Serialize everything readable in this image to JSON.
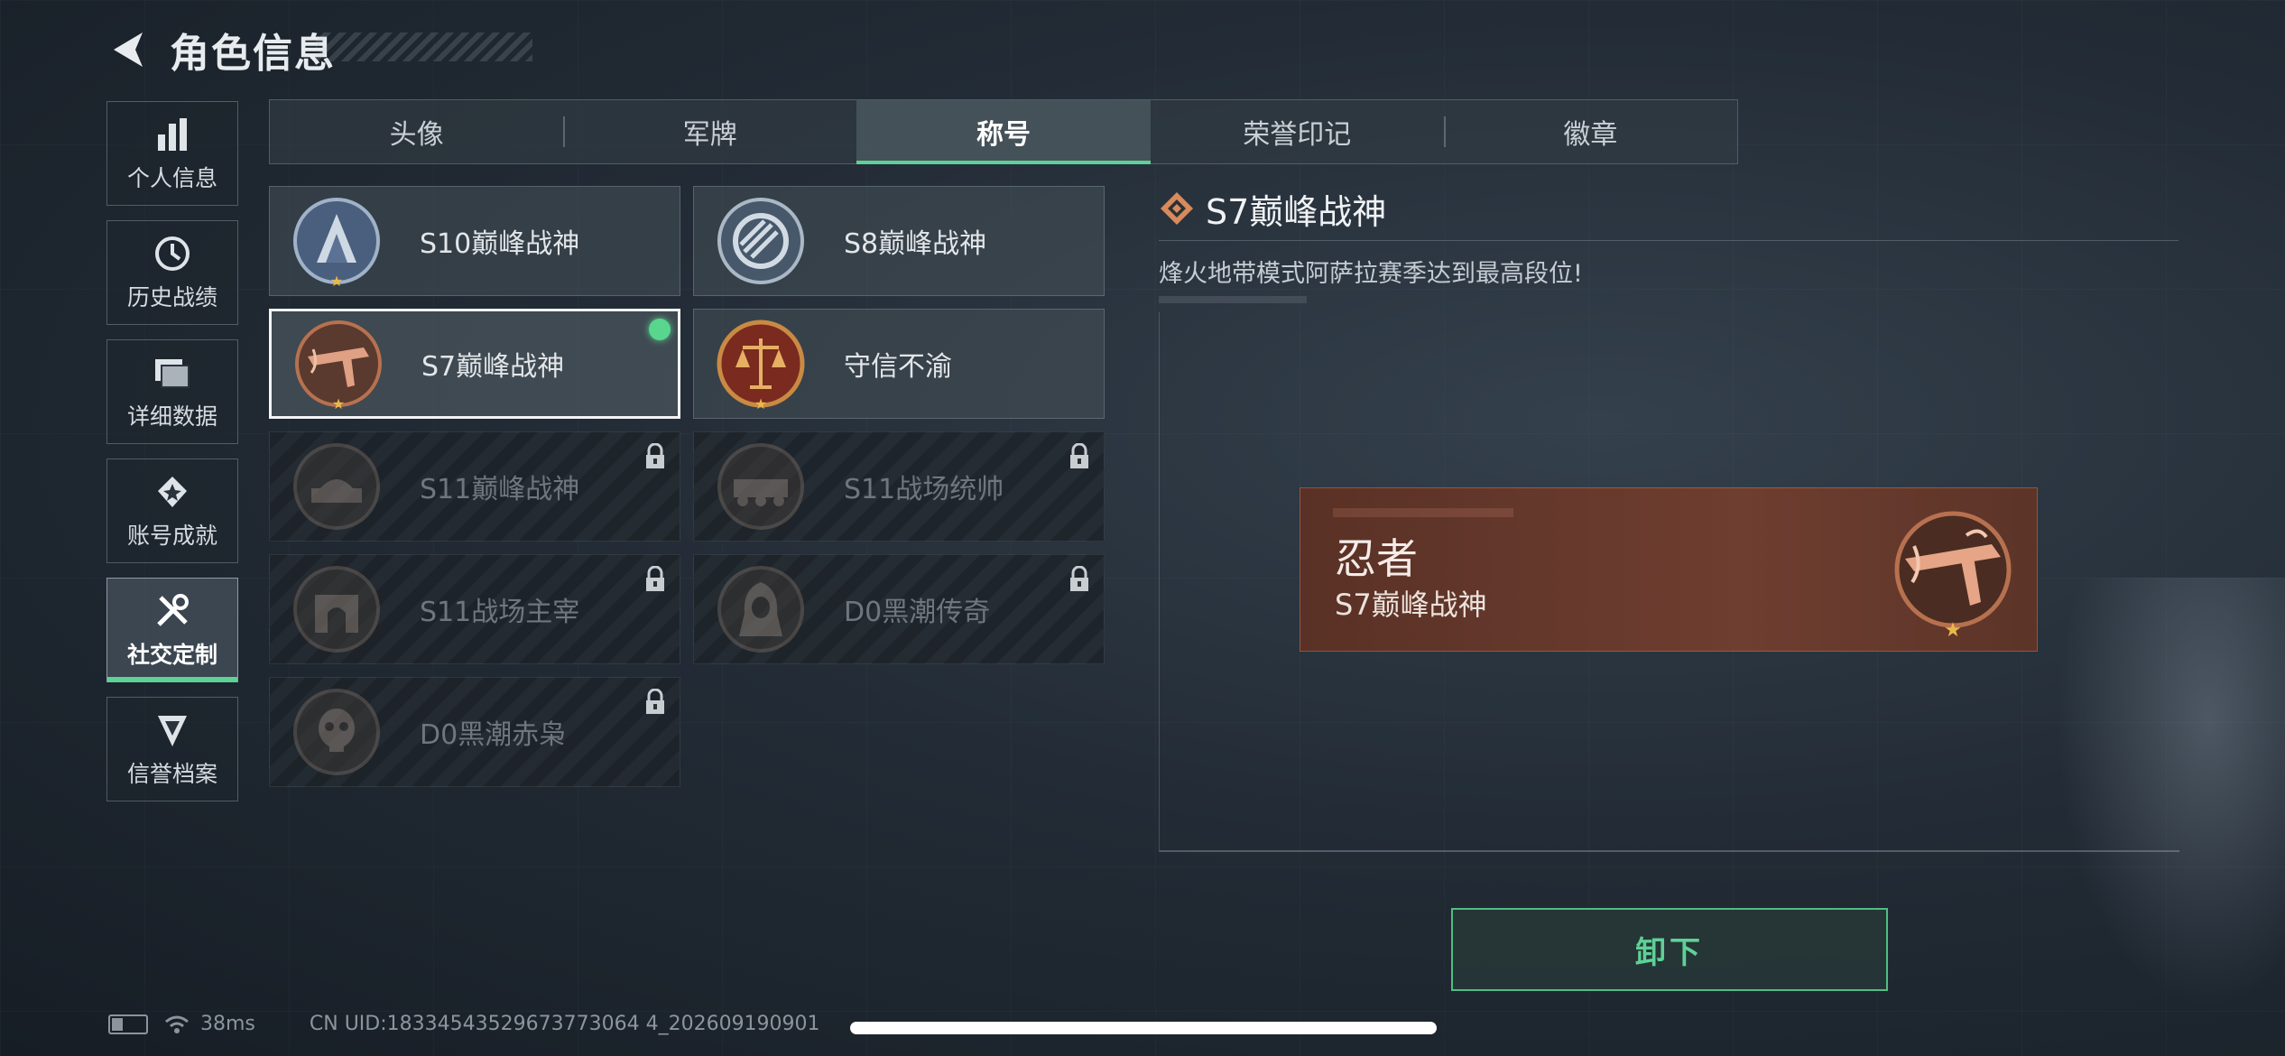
{
  "header": {
    "title": "角色信息"
  },
  "sidebar": {
    "items": [
      {
        "label": "个人信息",
        "icon": "bar-chart-icon",
        "active": false
      },
      {
        "label": "历史战绩",
        "icon": "clock-icon",
        "active": false
      },
      {
        "label": "详细数据",
        "icon": "folder-icon",
        "active": false
      },
      {
        "label": "账号成就",
        "icon": "achievement-icon",
        "active": false
      },
      {
        "label": "社交定制",
        "icon": "tools-icon",
        "active": true
      },
      {
        "label": "信誉档案",
        "icon": "emblem-icon",
        "active": false
      }
    ]
  },
  "tabs": [
    {
      "label": "头像"
    },
    {
      "label": "军牌"
    },
    {
      "label": "称号",
      "active": true
    },
    {
      "label": "荣誉印记"
    },
    {
      "label": "徽章"
    }
  ],
  "titles": [
    {
      "name": "S10巅峰战神",
      "medal": "blue-silver-medal-icon",
      "locked": false
    },
    {
      "name": "S8巅峰战神",
      "medal": "silver-stripe-medal-icon",
      "locked": false
    },
    {
      "name": "S7巅峰战神",
      "medal": "crossbow-medal-icon",
      "locked": false,
      "selected": true,
      "equipped": true
    },
    {
      "name": "守信不渝",
      "medal": "scales-medal-icon",
      "locked": false
    },
    {
      "name": "S11巅峰战神",
      "medal": "tank-medal-icon",
      "locked": true
    },
    {
      "name": "S11战场统帅",
      "medal": "apc-medal-icon",
      "locked": true
    },
    {
      "name": "S11战场主宰",
      "medal": "arch-medal-icon",
      "locked": true
    },
    {
      "name": "D0黑潮传奇",
      "medal": "hooded-figure-medal-icon",
      "locked": true
    },
    {
      "name": "D0黑潮赤枭",
      "medal": "skull-medal-icon",
      "locked": true
    }
  ],
  "detail": {
    "title": "S7巅峰战神",
    "description": "烽火地带模式阿萨拉赛季达到最高段位!"
  },
  "nameplate": {
    "player_name": "忍者",
    "title": "S7巅峰战神"
  },
  "actions": {
    "unequip_label": "卸下"
  },
  "status_bar": {
    "latency": "38ms",
    "uid": "CN UID:18334543529673773064 4_202609190901"
  },
  "colors": {
    "accent_green": "#5ed196",
    "nameplate_bg": "#6e3e30",
    "medal_bronze": "#b7714f"
  }
}
